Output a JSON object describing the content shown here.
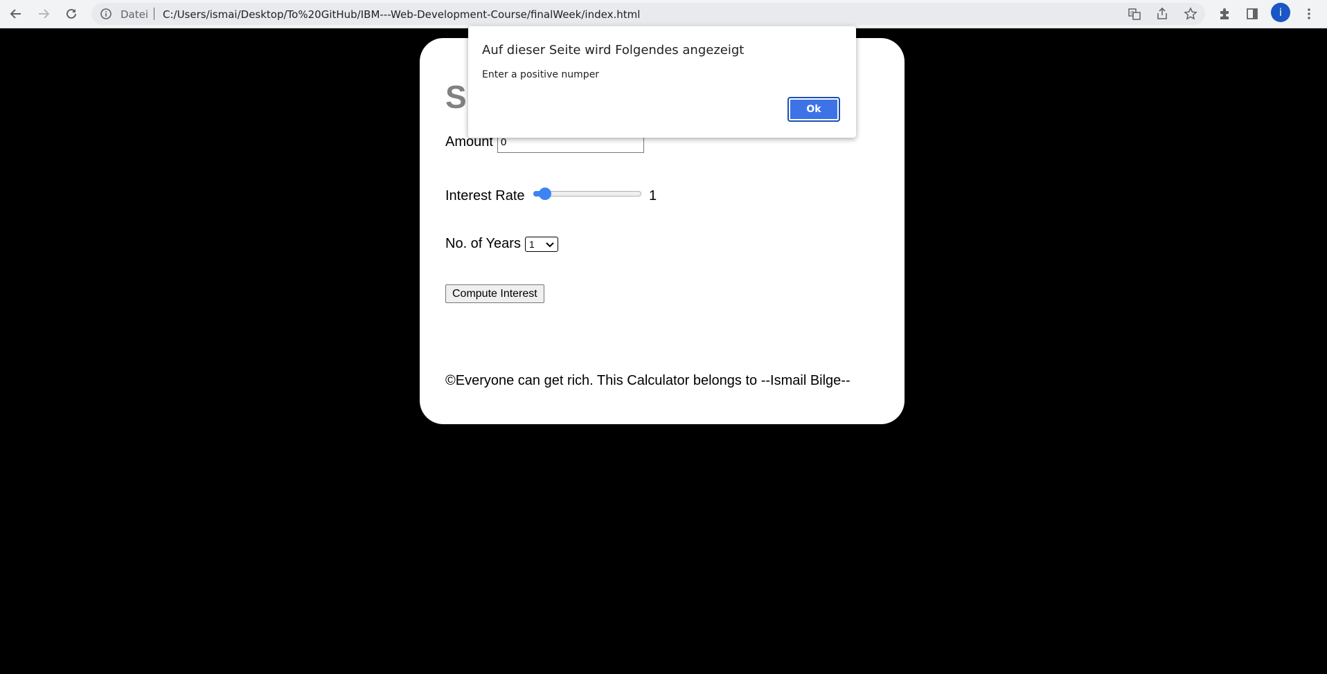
{
  "browser": {
    "scheme_label": "Datei",
    "url": "C:/Users/ismai/Desktop/To%20GitHub/IBM---Web-Development-Course/finalWeek/index.html",
    "profile_initial": "i",
    "icons": [
      "back-icon",
      "forward-icon",
      "reload-icon",
      "info-icon",
      "translate-icon",
      "share-icon",
      "star-icon",
      "extensions-icon",
      "side-panel-icon",
      "menu-icon"
    ]
  },
  "page": {
    "title": "Si",
    "amount_label": "Amount",
    "amount_value": "0",
    "interest_label": "Interest Rate",
    "interest_value": "1",
    "interest_fraction": 0.06,
    "years_label": "No. of Years",
    "years_selected": "1",
    "compute_label": "Compute Interest",
    "footer": "©Everyone can get rich. This Calculator belongs to --Ismail Bilge--"
  },
  "dialog": {
    "title": "Auf dieser Seite wird Folgendes angezeigt",
    "message": "Enter a positive numper",
    "ok_label": "Ok"
  },
  "colors": {
    "accent": "#3d83f5",
    "page_bg": "#000000",
    "card_bg": "#ffffff",
    "title_gray": "#808080",
    "dialog_button": "#3d73e7"
  }
}
